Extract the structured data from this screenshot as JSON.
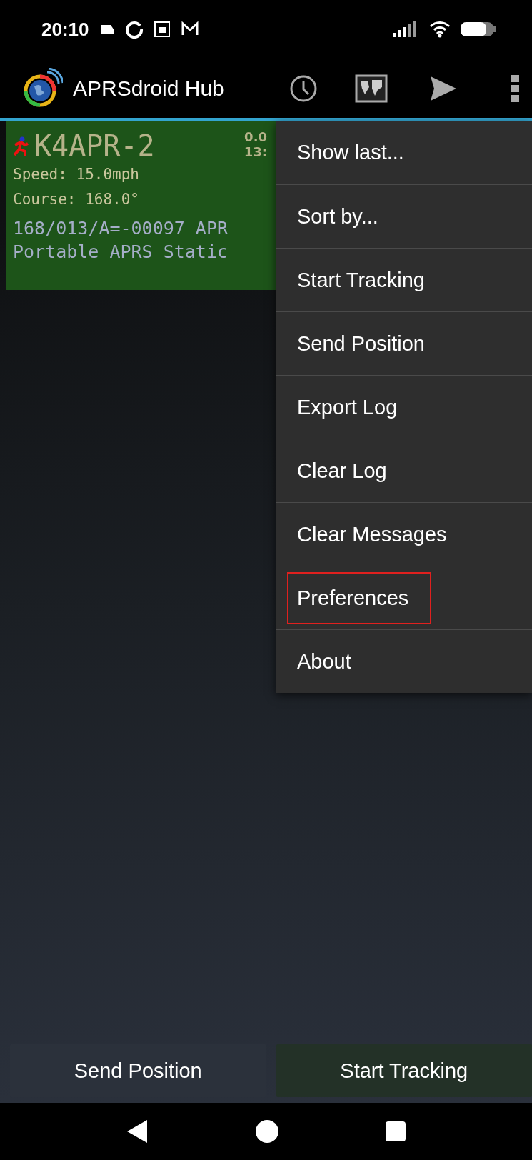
{
  "status_bar": {
    "time": "20:10"
  },
  "app_bar": {
    "title": "APRSdroid Hub"
  },
  "station": {
    "callsign": "K4APR-2",
    "distance": "0.0",
    "time": "13:",
    "lines": [
      "Speed: 15.0mph",
      "Course: 168.0°"
    ],
    "comment": [
      "168/013/A=-00097 APR",
      "Portable APRS Static"
    ]
  },
  "menu": {
    "items": [
      {
        "label": "Show last...",
        "highlighted": false
      },
      {
        "label": "Sort by...",
        "highlighted": false
      },
      {
        "label": "Start Tracking",
        "highlighted": false
      },
      {
        "label": "Send Position",
        "highlighted": false
      },
      {
        "label": "Export Log",
        "highlighted": false
      },
      {
        "label": "Clear Log",
        "highlighted": false
      },
      {
        "label": "Clear Messages",
        "highlighted": false
      },
      {
        "label": "Preferences",
        "highlighted": true
      },
      {
        "label": "About",
        "highlighted": false
      }
    ]
  },
  "buttons": [
    {
      "label": "Send Position",
      "kind": "plain"
    },
    {
      "label": "Start Tracking",
      "kind": "tinted"
    }
  ]
}
